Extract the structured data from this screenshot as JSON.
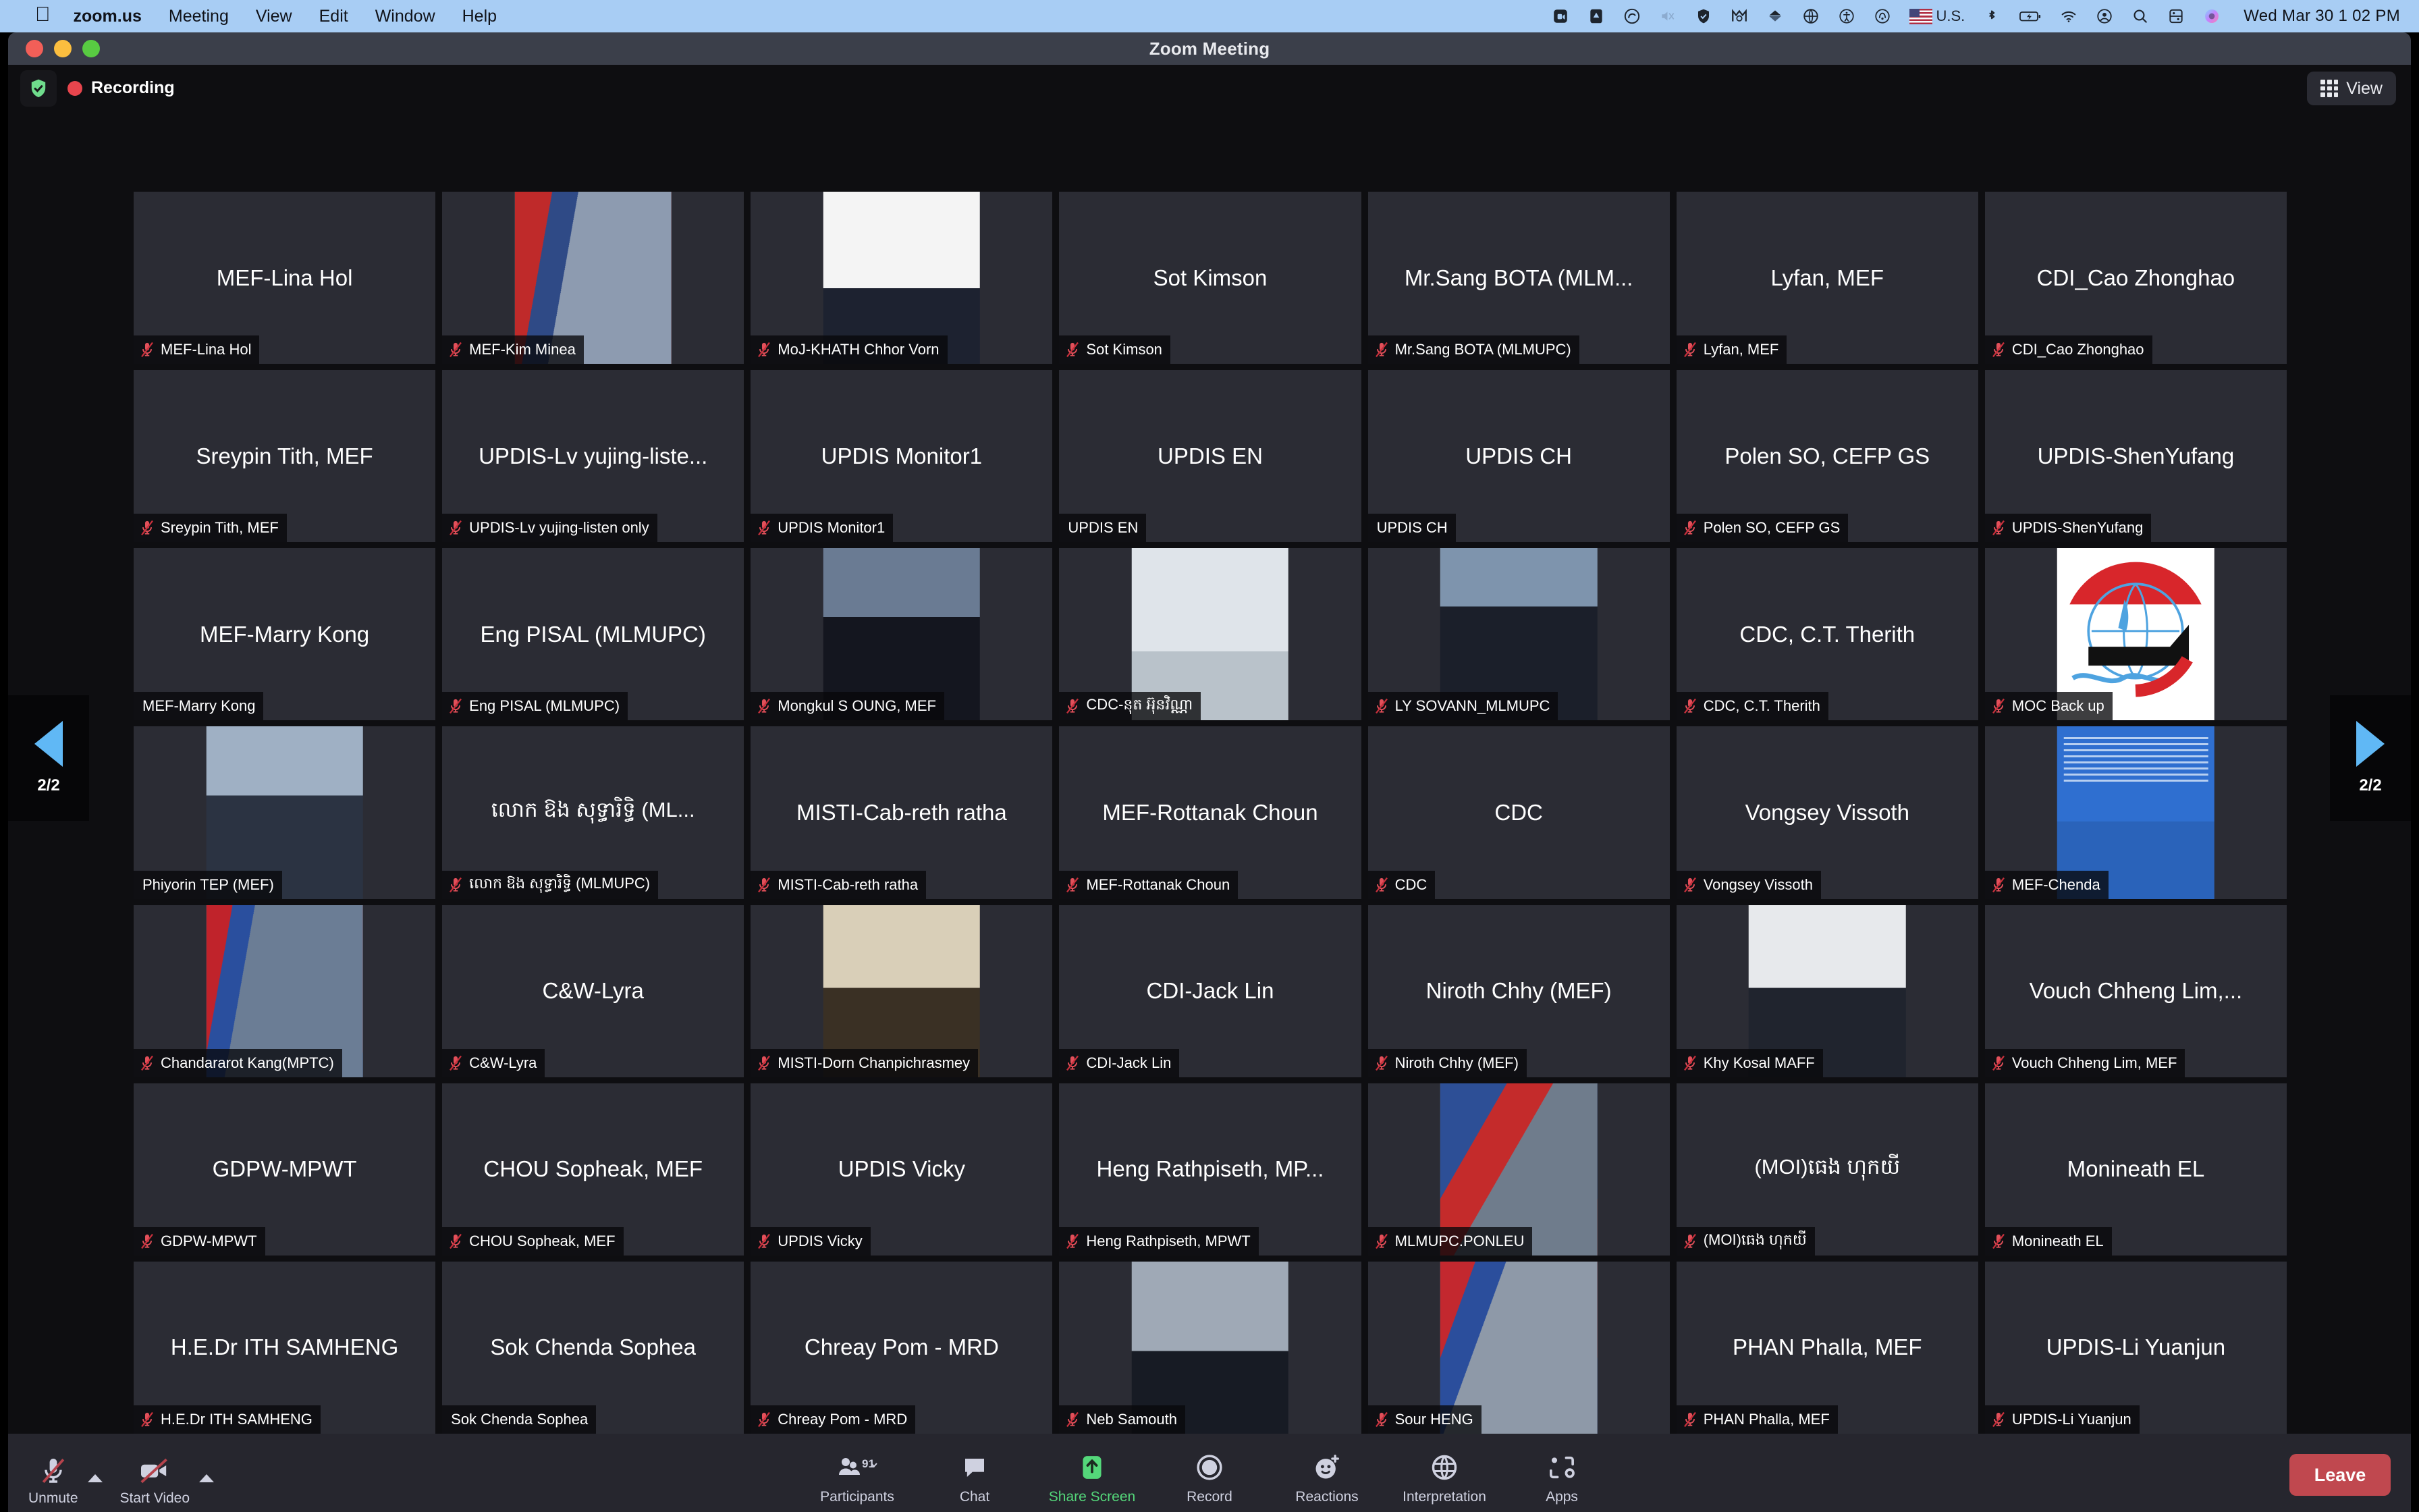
{
  "menubar": {
    "apple_icon": "apple-logo-icon",
    "items": [
      {
        "label": "zoom.us",
        "bold": true
      },
      {
        "label": "Meeting",
        "bold": false
      },
      {
        "label": "View",
        "bold": false
      },
      {
        "label": "Edit",
        "bold": false
      },
      {
        "label": "Window",
        "bold": false
      },
      {
        "label": "Help",
        "bold": false
      }
    ],
    "tray_icons": [
      "video-camera-icon",
      "display-brightness-icon",
      "adobe-creative-cloud-icon",
      "volume-mute-icon",
      "shield-check-icon",
      "mega-app-icon",
      "dropbox-icon",
      "globe-network-icon",
      "accessibility-icon",
      "airdrop-icon"
    ],
    "locale": "U.S.",
    "tray_icons_right": [
      "bluetooth-icon",
      "battery-charging-icon",
      "wifi-icon",
      "user-account-icon",
      "spotlight-search-icon",
      "control-center-icon",
      "siri-icon"
    ],
    "clock": "Wed Mar 30  1 02 PM"
  },
  "window": {
    "title": "Zoom Meeting",
    "traffic_lights": [
      "close-button",
      "minimize-button",
      "zoom-button"
    ]
  },
  "topbar": {
    "security_icon": "shield-check-icon",
    "recording_label": "Recording",
    "recording_dot_color": "#e8454d",
    "view_button": "View",
    "view_icon": "grid-view-icon"
  },
  "pagination": {
    "left_label": "2/2",
    "right_label": "2/2",
    "prev_icon": "chevron-left-icon",
    "next_icon": "chevron-right-icon"
  },
  "participants": [
    {
      "display": "MEF-Lina Hol",
      "name": "MEF-Lina Hol",
      "muted": true,
      "video": false
    },
    {
      "display": "",
      "name": "MEF-Kim Minea",
      "muted": true,
      "video": true,
      "vclass": "v-kim"
    },
    {
      "display": "",
      "name": "MoJ-KHATH Chhor Vorn",
      "muted": true,
      "video": true,
      "vclass": "v-khath"
    },
    {
      "display": "Sot Kimson",
      "name": "Sot Kimson",
      "muted": true,
      "video": false
    },
    {
      "display": "Mr.Sang BOTA (MLM...",
      "name": "Mr.Sang BOTA (MLMUPC)",
      "muted": true,
      "video": false
    },
    {
      "display": "Lyfan, MEF",
      "name": "Lyfan, MEF",
      "muted": true,
      "video": false
    },
    {
      "display": "CDI_Cao Zhonghao",
      "name": "CDI_Cao Zhonghao",
      "muted": true,
      "video": false
    },
    {
      "display": "Sreypin Tith, MEF",
      "name": "Sreypin Tith, MEF",
      "muted": true,
      "video": false
    },
    {
      "display": "UPDIS-Lv yujing-liste...",
      "name": "UPDIS-Lv yujing-listen only",
      "muted": true,
      "video": false
    },
    {
      "display": "UPDIS Monitor1",
      "name": "UPDIS Monitor1",
      "muted": true,
      "video": false
    },
    {
      "display": "UPDIS EN",
      "name": "UPDIS EN",
      "muted": false,
      "video": false
    },
    {
      "display": "UPDIS CH",
      "name": "UPDIS CH",
      "muted": false,
      "video": false
    },
    {
      "display": "Polen SO, CEFP GS",
      "name": "Polen SO, CEFP GS",
      "muted": true,
      "video": false
    },
    {
      "display": "UPDIS-ShenYufang",
      "name": "UPDIS-ShenYufang",
      "muted": true,
      "video": false
    },
    {
      "display": "MEF-Marry Kong",
      "name": "MEF-Marry Kong",
      "muted": false,
      "video": false
    },
    {
      "display": "Eng PISAL (MLMUPC)",
      "name": "Eng PISAL (MLMUPC)",
      "muted": true,
      "video": false
    },
    {
      "display": "",
      "name": "Mongkul S OUNG, MEF",
      "muted": true,
      "video": true,
      "vclass": "v-mongkul"
    },
    {
      "display": "",
      "name": "CDC-នុត អ៊ុនវិណ្ណា",
      "muted": true,
      "video": true,
      "vclass": "v-cdcnut"
    },
    {
      "display": "",
      "name": "LY SOVANN_MLMUPC",
      "muted": true,
      "video": true,
      "vclass": "v-sovann"
    },
    {
      "display": "CDC, C.T. Therith",
      "name": "CDC, C.T. Therith",
      "muted": true,
      "video": false
    },
    {
      "display": "",
      "name": "MOC Back up",
      "muted": true,
      "video": true,
      "vclass": "v-moc"
    },
    {
      "display": "",
      "name": "Phiyorin TEP (MEF)",
      "muted": false,
      "video": true,
      "vclass": "v-phiyorin"
    },
    {
      "display": "លោក ឱង សុទ្ធារិទ្ធិ (ML...",
      "name": "លោក ឱង សុទ្ធារិទ្ធិ (MLMUPC)",
      "muted": true,
      "video": false,
      "khmer": true
    },
    {
      "display": "MISTI-Cab-reth ratha",
      "name": "MISTI-Cab-reth ratha",
      "muted": true,
      "video": false
    },
    {
      "display": "MEF-Rottanak Choun",
      "name": "MEF-Rottanak Choun",
      "muted": true,
      "video": false
    },
    {
      "display": "CDC",
      "name": "CDC",
      "muted": true,
      "video": false
    },
    {
      "display": "Vongsey Vissoth",
      "name": "Vongsey Vissoth",
      "muted": true,
      "video": false
    },
    {
      "display": "",
      "name": "MEF-Chenda",
      "muted": true,
      "video": true,
      "vclass": "v-chenda"
    },
    {
      "display": "",
      "name": "Chandararot Kang(MPTC)",
      "muted": true,
      "video": true,
      "vclass": "v-chandararot"
    },
    {
      "display": "C&W-Lyra",
      "name": "C&W-Lyra",
      "muted": true,
      "video": false
    },
    {
      "display": "",
      "name": "MISTI-Dorn Chanpichrasmey",
      "muted": true,
      "video": true,
      "vclass": "v-dorn"
    },
    {
      "display": "CDI-Jack Lin",
      "name": "CDI-Jack Lin",
      "muted": true,
      "video": false
    },
    {
      "display": "Niroth Chhy (MEF)",
      "name": "Niroth Chhy (MEF)",
      "muted": true,
      "video": false
    },
    {
      "display": "",
      "name": "Khy Kosal MAFF",
      "muted": true,
      "video": true,
      "vclass": "v-khy"
    },
    {
      "display": "Vouch Chheng Lim,...",
      "name": "Vouch Chheng Lim, MEF",
      "muted": true,
      "video": false
    },
    {
      "display": "GDPW-MPWT",
      "name": "GDPW-MPWT",
      "muted": true,
      "video": false
    },
    {
      "display": "CHOU Sopheak, MEF",
      "name": "CHOU Sopheak, MEF",
      "muted": true,
      "video": false
    },
    {
      "display": "UPDIS Vicky",
      "name": "UPDIS Vicky",
      "muted": true,
      "video": false
    },
    {
      "display": "Heng Rathpiseth, MP...",
      "name": "Heng Rathpiseth, MPWT",
      "muted": true,
      "video": false
    },
    {
      "display": "",
      "name": "MLMUPC.PONLEU",
      "muted": true,
      "video": true,
      "vclass": "v-ponleu"
    },
    {
      "display": "(MOI)ធេង ហុកយី",
      "name": "(MOI)ធេង ហុកយី",
      "muted": true,
      "video": false,
      "khmer": true
    },
    {
      "display": "Monineath EL",
      "name": "Monineath EL",
      "muted": true,
      "video": false
    },
    {
      "display": "H.E.Dr ITH SAMHENG",
      "name": "H.E.Dr ITH SAMHENG",
      "muted": true,
      "video": false
    },
    {
      "display": "Sok Chenda Sophea",
      "name": "Sok Chenda Sophea",
      "muted": false,
      "video": false
    },
    {
      "display": "Chreay Pom - MRD",
      "name": "Chreay Pom - MRD",
      "muted": true,
      "video": false
    },
    {
      "display": "",
      "name": "Neb Samouth",
      "muted": true,
      "video": true,
      "vclass": "v-neb"
    },
    {
      "display": "",
      "name": "Sour HENG",
      "muted": true,
      "video": true,
      "vclass": "v-sour"
    },
    {
      "display": "PHAN Phalla, MEF",
      "name": "PHAN Phalla, MEF",
      "muted": true,
      "video": false
    },
    {
      "display": "UPDIS-Li Yuanjun",
      "name": "UPDIS-Li Yuanjun",
      "muted": true,
      "video": false
    }
  ],
  "toolbar": {
    "left": [
      {
        "label": "Unmute",
        "icon": "microphone-muted-icon",
        "caret": true
      },
      {
        "label": "Start Video",
        "icon": "video-camera-muted-icon",
        "caret": true
      }
    ],
    "center": [
      {
        "label": "Participants",
        "icon": "participants-icon",
        "count": "91",
        "caret": true
      },
      {
        "label": "Chat",
        "icon": "chat-bubble-icon",
        "caret": false
      },
      {
        "label": "Share Screen",
        "icon": "share-screen-icon",
        "caret": false,
        "accent": "#54d77a"
      },
      {
        "label": "Record",
        "icon": "record-circle-icon",
        "caret": false
      },
      {
        "label": "Reactions",
        "icon": "reactions-smiley-icon",
        "caret": false
      },
      {
        "label": "Interpretation",
        "icon": "globe-interpretation-icon",
        "caret": false
      },
      {
        "label": "Apps",
        "icon": "apps-icon",
        "caret": false
      }
    ],
    "leave_label": "Leave",
    "leave_color": "#c0484f"
  }
}
